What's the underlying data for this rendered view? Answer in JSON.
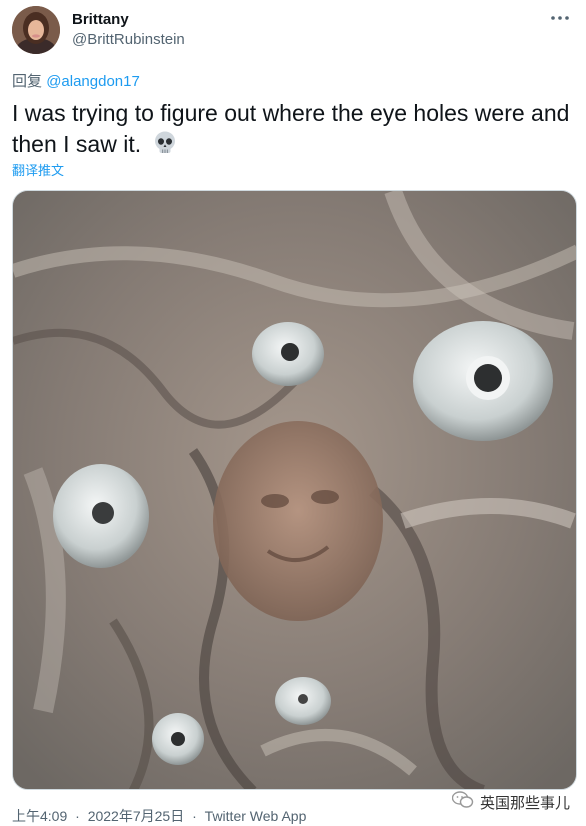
{
  "author": {
    "display_name": "Brittany",
    "handle": "@BrittRubinstein"
  },
  "reply": {
    "prefix": "回复",
    "mention": "@alangdon17"
  },
  "tweet": {
    "text": "I was trying to figure out where the eye holes were and then I saw it.",
    "emoji": "skull",
    "translate_label": "翻译推文"
  },
  "media": {
    "description_icon": "photo"
  },
  "footer": {
    "time": "上午4:09",
    "date": "2022年7月25日",
    "separator": "·",
    "source": "Twitter Web App"
  },
  "watermark": {
    "text": "英国那些事儿",
    "icon": "wechat-icon"
  },
  "colors": {
    "accent": "#1d9bf0",
    "secondary_text": "#536471",
    "primary_text": "#0f1419"
  }
}
